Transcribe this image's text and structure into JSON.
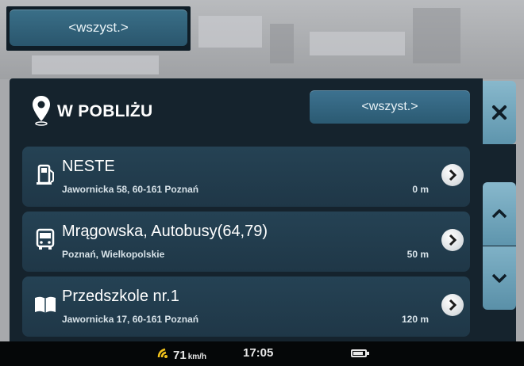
{
  "top_filter": {
    "label": "<wszyst.>"
  },
  "panel": {
    "title": "W POBLIŻU",
    "filter_label": "<wszyst.>",
    "pin_icon": "location-pin-icon"
  },
  "poi_list": [
    {
      "name": "NESTE",
      "address": "Jawornicka 58, 60-161 Poznań",
      "distance": "0 m",
      "icon": "fuel-pump-icon"
    },
    {
      "name": "Mrągowska, Autobusy(64,79)",
      "address": "Poznań, Wielkopolskie",
      "distance": "50 m",
      "icon": "bus-icon"
    },
    {
      "name": "Przedszkole nr.1",
      "address": "Jawornicka 17, 60-161 Poznań",
      "distance": "120 m",
      "icon": "book-icon"
    }
  ],
  "controls": {
    "close_icon": "close-icon",
    "up_icon": "chevron-up-icon",
    "down_icon": "chevron-down-icon"
  },
  "status": {
    "speed": "71",
    "speed_unit": "km/h",
    "time": "17:05",
    "battery_level": 0.75
  },
  "colors": {
    "panel_bg": "#15232d",
    "item_bg": "#254254",
    "button_accent": "#2b5a72",
    "side_button": "#5e95ad"
  }
}
